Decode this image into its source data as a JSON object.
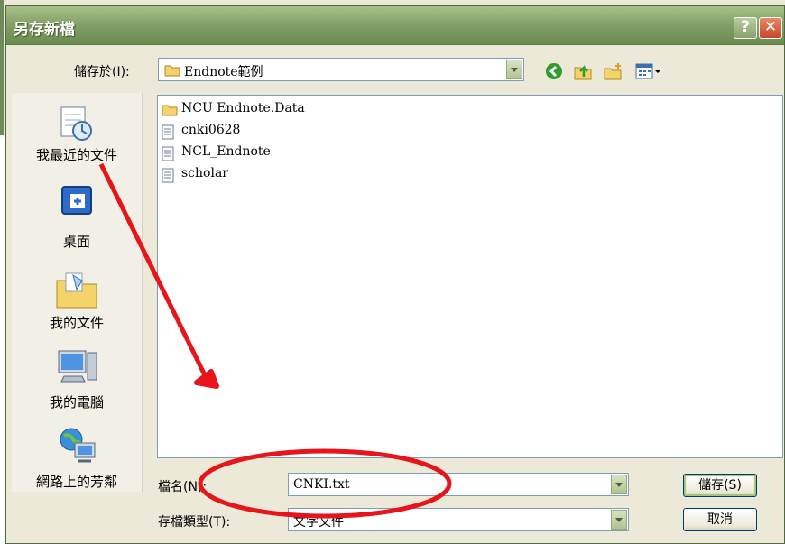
{
  "dialog": {
    "title": "另存新檔",
    "help_glyph": "?",
    "close_glyph": "✕"
  },
  "save_in": {
    "label": "儲存於(I):",
    "value": "Endnote範例"
  },
  "toolbar": {
    "back_icon": "back-icon",
    "up_icon": "up-folder-icon",
    "new_folder_icon": "new-folder-icon",
    "views_icon": "views-menu-icon"
  },
  "places": [
    {
      "label": "我最近的文件",
      "icon": "recent-documents-icon"
    },
    {
      "label": "桌面",
      "icon": "desktop-icon"
    },
    {
      "label": "我的文件",
      "icon": "my-documents-icon"
    },
    {
      "label": "我的電腦",
      "icon": "my-computer-icon"
    },
    {
      "label": "網路上的芳鄰",
      "icon": "network-places-icon"
    }
  ],
  "files": [
    {
      "name": "NCU Endnote.Data",
      "type": "folder"
    },
    {
      "name": "cnki0628",
      "type": "file"
    },
    {
      "name": "NCL_Endnote",
      "type": "file"
    },
    {
      "name": "scholar",
      "type": "file"
    }
  ],
  "filename": {
    "label": "檔名(N):",
    "value": "CNKI.txt"
  },
  "filetype": {
    "label": "存檔類型(T):",
    "value": "文字文件"
  },
  "buttons": {
    "save": "儲存(S)",
    "cancel": "取消"
  },
  "colors": {
    "annotation": "#e8141b",
    "title_bar": "#7f9c62"
  }
}
